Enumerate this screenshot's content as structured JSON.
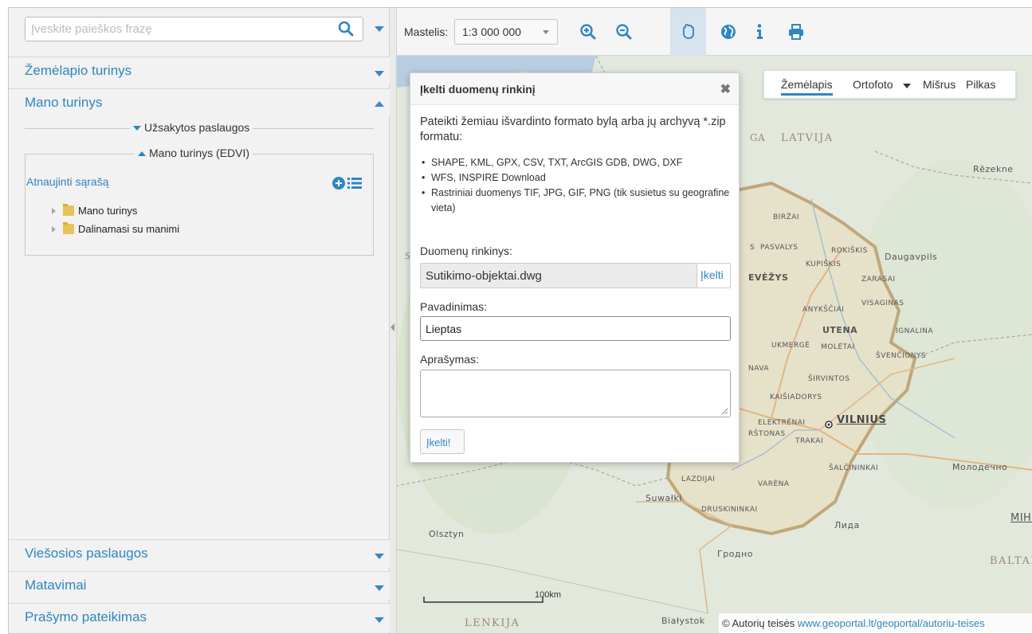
{
  "search": {
    "placeholder": "Įveskite paieškos frazę"
  },
  "sidebar": {
    "zemelapio_turinys": "Žemėlapio turinys",
    "mano_turinys": "Mano turinys",
    "uzsakytos_paslaugos": "Užsakytos paslaugos",
    "mano_turinys_edvi": "Mano turinys (EDVI)",
    "atnaujinti_sarasa": "Atnaujinti sąrašą",
    "tree": [
      "Mano turinys",
      "Dalinamasi su manimi"
    ],
    "viesosios_paslaugos": "Viešosios paslaugos",
    "matavimai": "Matavimai",
    "prasymo_pateikimas": "Prašymo pateikimas"
  },
  "toolbar": {
    "scale_label": "Mastelis:",
    "scale_value": "1:3 000 000",
    "buttons": [
      "zoom-in-icon",
      "zoom-out-icon",
      "pan-hand-icon",
      "globe-icon",
      "info-icon",
      "print-icon"
    ]
  },
  "map_types": {
    "zemelapis": "Žemėlapis",
    "ortofoto": "Ortofoto",
    "misrus": "Mišrus",
    "pilkas": "Pilkas"
  },
  "dialog": {
    "title": "Įkelti duomenų rinkinį",
    "intro": "Pateikti žemiau išvardinto formato bylą arba jų archyvą *.zip formatu:",
    "formats": [
      "SHAPE, KML, GPX, CSV, TXT, ArcGIS GDB, DWG, DXF",
      "WFS, INSPIRE Download",
      "Rastriniai duomenys TIF, JPG, GIF, PNG (tik susietus su geografine vieta)"
    ],
    "dataset_label": "Duomenų rinkinys:",
    "dataset_file": "Sutikimo-objektai.dwg",
    "upload_label": "Įkelti",
    "name_label": "Pavadinimas:",
    "name_value": "Lieptas",
    "desc_label": "Aprašymas:",
    "desc_value": "",
    "submit_label": "Įkelti!"
  },
  "map_labels": {
    "latvija": "LATVIJA",
    "ga": "GA",
    "rezekne": "Rēzekne",
    "birzai": "BIRŽAI",
    "pasvalys": "PASVALYS",
    "s": "S",
    "rokiskis": "ROKIŠKIS",
    "daugavpils": "Daugavpils",
    "kupiskis": "KUPIŠKIS",
    "evezys": "EVĖŽYS",
    "zarasai": "ZARASAI",
    "anyksciai": "ANYKŠČIAI",
    "visaginas": "VISAGINAS",
    "utena": "UTENA",
    "ignalina": "IGNALINA",
    "ukmerge": "UKMERGĖ",
    "moletai": "MOLĖTAI",
    "svencionys": "ŠVENČIONYS",
    "nava": "NAVA",
    "sirvintos": "ŠIRVINTOS",
    "kaisiadorys": "KAIŠIADORYS",
    "elektrenai": "ELEKTRĖNAI",
    "vilnius": "VILNIUS",
    "rstonas": "RŠTONAS",
    "trakai": "TRAKAI",
    "salcininkai": "ŠALČININKAI",
    "molodechno": "Молодечно",
    "lazdijai": "LAZDIJAI",
    "varena": "VARĖNA",
    "suwalki": "Suwałki",
    "druskininkai": "DRUSKININKAI",
    "minsk": "МІНС",
    "lida": "Лида",
    "olsztyn": "Olsztyn",
    "grodno": "Гродно",
    "baltar": "BALTAR",
    "lenkija": "LENKIJA",
    "bialystok": "Białystok",
    "scale_100km": "100km"
  },
  "copyright": {
    "text": "© Autorių teisės",
    "link": "www.geoportal.lt/geoportal/autoriu-teises"
  },
  "colors": {
    "accent": "#2f86c2",
    "lithuania_border": "#9b7a45",
    "map_bg": "#dfe6da"
  }
}
